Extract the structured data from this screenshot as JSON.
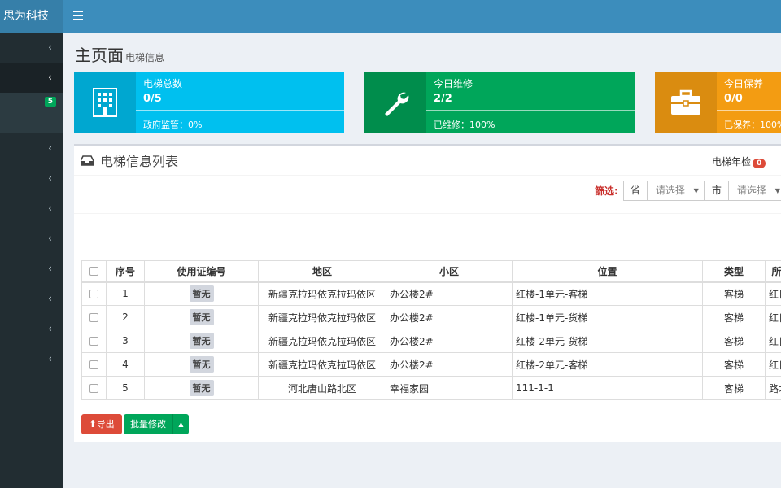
{
  "app": {
    "title": "思为科技"
  },
  "sidebar": {
    "items": [
      {
        "chev": "‹"
      },
      {
        "chev": "‹"
      },
      {
        "badge": "5"
      },
      {
        "chev": "‹"
      },
      {
        "chev": "‹"
      },
      {
        "chev": "‹"
      },
      {
        "chev": "‹"
      },
      {
        "chev": "‹"
      },
      {
        "chev": "‹"
      },
      {
        "chev": "‹"
      },
      {
        "chev": "‹"
      }
    ]
  },
  "page": {
    "title": "主页面",
    "subtitle": "电梯信息"
  },
  "stats": [
    {
      "label": "电梯总数",
      "value": "0/5",
      "desc": "政府监管：0%",
      "color": "#00c0ef",
      "icon": "building-icon"
    },
    {
      "label": "今日维修",
      "value": "2/2",
      "desc": "已维修：100%",
      "color": "#00a65a",
      "icon": "wrench-icon"
    },
    {
      "label": "今日保养",
      "value": "0/0",
      "desc": "已保养：100%",
      "color": "#f39c12",
      "icon": "briefcase-icon"
    }
  ],
  "list": {
    "title": "电梯信息列表",
    "annual_label": "电梯年检",
    "annual_count": "0",
    "filter": {
      "label": "篩选:",
      "province_label": "省",
      "province_value": "请选择",
      "city_label": "市",
      "city_value": "请选择"
    },
    "columns": [
      "序号",
      "使用证编号",
      "地区",
      "小区",
      "位置",
      "类型",
      "所属"
    ],
    "rows": [
      {
        "no": "1",
        "cert": "暂无",
        "region": "新疆克拉玛依克拉玛依区",
        "community": "办公楼2#",
        "location": "红楼-1单元-客梯",
        "type": "客梯",
        "extra": "红日"
      },
      {
        "no": "2",
        "cert": "暂无",
        "region": "新疆克拉玛依克拉玛依区",
        "community": "办公楼2#",
        "location": "红楼-1单元-货梯",
        "type": "客梯",
        "extra": "红日"
      },
      {
        "no": "3",
        "cert": "暂无",
        "region": "新疆克拉玛依克拉玛依区",
        "community": "办公楼2#",
        "location": "红楼-2单元-货梯",
        "type": "客梯",
        "extra": "红日"
      },
      {
        "no": "4",
        "cert": "暂无",
        "region": "新疆克拉玛依克拉玛依区",
        "community": "办公楼2#",
        "location": "红楼-2单元-客梯",
        "type": "客梯",
        "extra": "红日"
      },
      {
        "no": "5",
        "cert": "暂无",
        "region": "河北唐山路北区",
        "community": "幸福家园",
        "location": "111-1-1",
        "type": "客梯",
        "extra": "路北"
      }
    ],
    "export_label": "导出",
    "batch_label": "批量修改",
    "caret": "▲"
  }
}
